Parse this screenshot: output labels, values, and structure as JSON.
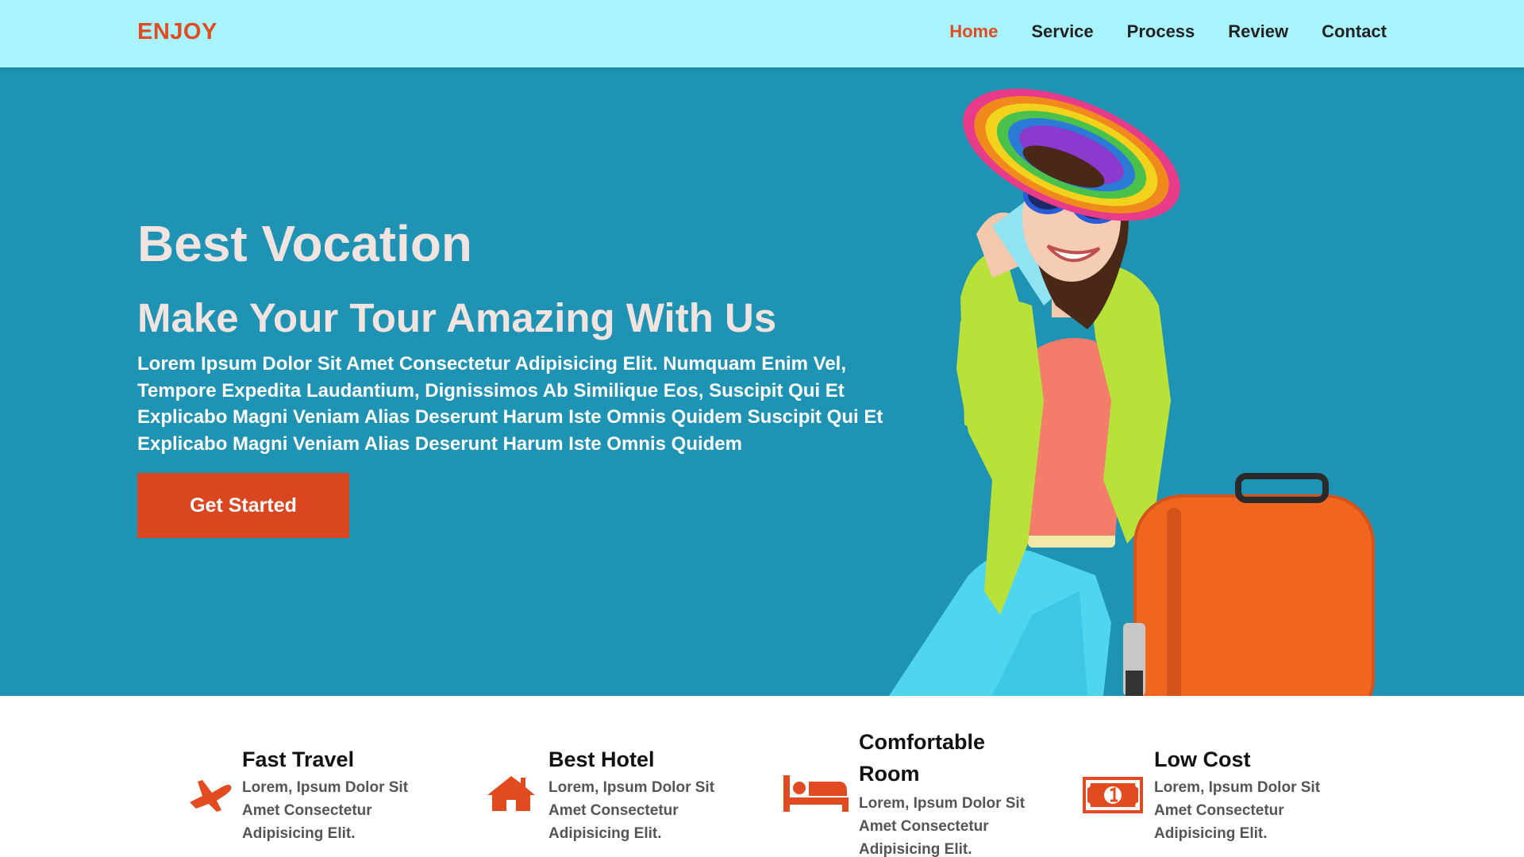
{
  "header": {
    "logo": "ENJOY",
    "nav": [
      "Home",
      "Service",
      "Process",
      "Review",
      "Contact"
    ],
    "active": "Home"
  },
  "hero": {
    "title": "Best Vocation",
    "subtitle": "Make Your Tour Amazing With Us",
    "text": "Lorem Ipsum Dolor Sit Amet Consectetur Adipisicing Elit. Numquam Enim Vel, Tempore Expedita Laudantium, Dignissimos Ab Similique Eos, Suscipit Qui Et Explicabo Magni Veniam Alias Deserunt Harum Iste Omnis Quidem Suscipit Qui Et Explicabo Magni Veniam Alias Deserunt Harum Iste Omnis Quidem",
    "cta": "Get Started"
  },
  "features": [
    {
      "title": "Fast Travel",
      "text": "Lorem, Ipsum Dolor Sit Amet Consectetur Adipisicing Elit.",
      "icon": "plane-icon"
    },
    {
      "title": "Best Hotel",
      "text": "Lorem, Ipsum Dolor Sit Amet Consectetur Adipisicing Elit.",
      "icon": "house-icon"
    },
    {
      "title": "Comfortable Room",
      "text": "Lorem, Ipsum Dolor Sit Amet Consectetur Adipisicing Elit.",
      "icon": "bed-icon"
    },
    {
      "title": "Low Cost",
      "text": "Lorem, Ipsum Dolor Sit Amet Consectetur Adipisicing Elit.",
      "icon": "money-icon"
    }
  ],
  "colors": {
    "accent": "#e14b1f",
    "header_bg": "#a8f4ff",
    "hero_bg": "#1f93b3"
  }
}
